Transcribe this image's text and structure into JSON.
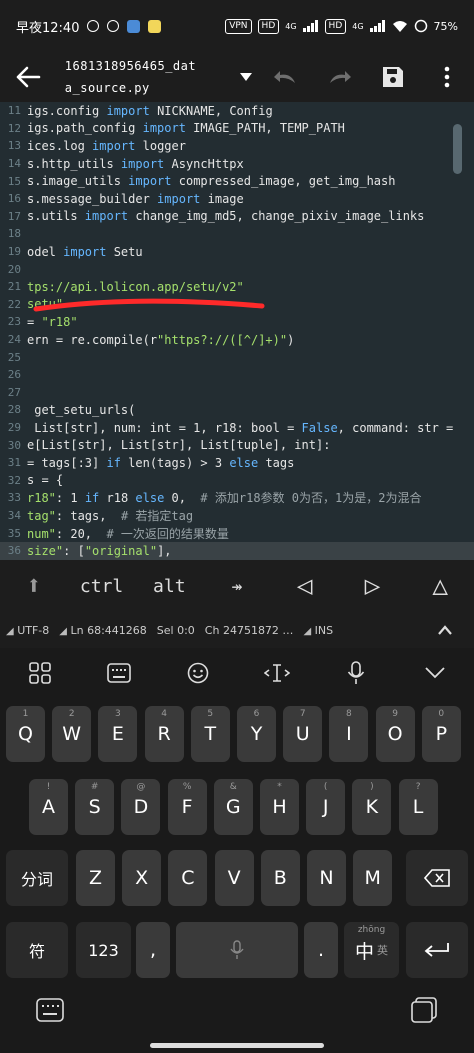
{
  "status_bar": {
    "time": "早夜12:40",
    "vpn": "VPN",
    "hd1": "HD",
    "net1": "4G",
    "hd2": "HD",
    "net2": "4G",
    "battery": "75%"
  },
  "toolbar": {
    "file_line1": "1681318956465_dat",
    "file_line2": "a_source.py"
  },
  "editor": {
    "lines": [
      {
        "n": "11",
        "segs": [
          [
            "def",
            "igs.config "
          ],
          [
            "kw",
            "import"
          ],
          [
            "def",
            " NICKNAME, Config"
          ]
        ]
      },
      {
        "n": "12",
        "segs": [
          [
            "def",
            "igs.path_config "
          ],
          [
            "kw",
            "import"
          ],
          [
            "def",
            " IMAGE_PATH, TEMP_PATH"
          ]
        ]
      },
      {
        "n": "13",
        "segs": [
          [
            "def",
            "ices.log "
          ],
          [
            "kw",
            "import"
          ],
          [
            "def",
            " logger"
          ]
        ]
      },
      {
        "n": "14",
        "segs": [
          [
            "def",
            "s.http_utils "
          ],
          [
            "kw",
            "import"
          ],
          [
            "def",
            " AsyncHttpx"
          ]
        ]
      },
      {
        "n": "15",
        "segs": [
          [
            "def",
            "s.image_utils "
          ],
          [
            "kw",
            "import"
          ],
          [
            "def",
            " compressed_image, get_img_hash"
          ]
        ]
      },
      {
        "n": "16",
        "segs": [
          [
            "def",
            "s.message_builder "
          ],
          [
            "kw",
            "import"
          ],
          [
            "def",
            " image"
          ]
        ]
      },
      {
        "n": "17",
        "segs": [
          [
            "def",
            "s.utils "
          ],
          [
            "kw",
            "import"
          ],
          [
            "def",
            " change_img_md5, change_pixiv_image_links"
          ]
        ]
      },
      {
        "n": "18",
        "segs": []
      },
      {
        "n": "19",
        "segs": [
          [
            "def",
            "odel "
          ],
          [
            "kw",
            "import"
          ],
          [
            "def",
            " Setu"
          ]
        ]
      },
      {
        "n": "20",
        "segs": []
      },
      {
        "n": "21",
        "segs": [
          [
            "str",
            "tps://api.lolicon.app/setu/v2\""
          ]
        ]
      },
      {
        "n": "22",
        "segs": [
          [
            "str",
            "setu\""
          ]
        ]
      },
      {
        "n": "23",
        "segs": [
          [
            "def",
            "= "
          ],
          [
            "str",
            "\"r18\""
          ]
        ]
      },
      {
        "n": "24",
        "segs": [
          [
            "def",
            "ern = re.compile(r"
          ],
          [
            "str",
            "\"https?://([^/]+)\""
          ],
          [
            "def",
            ")"
          ]
        ]
      },
      {
        "n": "25",
        "segs": []
      },
      {
        "n": "26",
        "segs": []
      },
      {
        "n": "27",
        "segs": []
      },
      {
        "n": "28",
        "segs": [
          [
            "def",
            " get_setu_urls("
          ]
        ]
      },
      {
        "n": "29",
        "segs": [
          [
            "def",
            " List[str], num: int = 1, r18: bool = "
          ],
          [
            "kw",
            "False"
          ],
          [
            "def",
            ", command: str ="
          ]
        ]
      },
      {
        "n": "30",
        "segs": [
          [
            "def",
            "e[List[str], List[str], List[tuple], int]:"
          ]
        ]
      },
      {
        "n": "31",
        "segs": [
          [
            "def",
            "= tags[:3] "
          ],
          [
            "kw",
            "if"
          ],
          [
            "def",
            " len(tags) > 3 "
          ],
          [
            "kw",
            "else"
          ],
          [
            "def",
            " tags"
          ]
        ]
      },
      {
        "n": "32",
        "segs": [
          [
            "def",
            "s = {"
          ]
        ]
      },
      {
        "n": "33",
        "segs": [
          [
            "str",
            "r18\""
          ],
          [
            "def",
            ": 1 "
          ],
          [
            "kw",
            "if"
          ],
          [
            "def",
            " r18 "
          ],
          [
            "kw",
            "else"
          ],
          [
            "def",
            " 0,  "
          ],
          [
            "cm",
            "# 添加r18参数 0为否，1为是，2为混合"
          ]
        ]
      },
      {
        "n": "34",
        "segs": [
          [
            "str",
            "tag\""
          ],
          [
            "def",
            ": tags,  "
          ],
          [
            "cm",
            "# 若指定tag"
          ]
        ]
      },
      {
        "n": "35",
        "segs": [
          [
            "str",
            "num\""
          ],
          [
            "def",
            ": 20,  "
          ],
          [
            "cm",
            "# 一次返回的结果数量"
          ]
        ]
      },
      {
        "n": "36",
        "segs": [
          [
            "str",
            "size\""
          ],
          [
            "def",
            ": ["
          ],
          [
            "str",
            "\"original\""
          ],
          [
            "def",
            "],"
          ]
        ]
      }
    ],
    "current_line": "36"
  },
  "symbol_bar": {
    "keys": [
      "⬆",
      "ctrl",
      "alt",
      "↠",
      "◁",
      "▷",
      "△"
    ]
  },
  "info_bar": {
    "encoding": "UTF-8",
    "position": "Ln 68:441268",
    "selection": "Sel 0:0",
    "chars": "Ch 24751872 …",
    "mode": "INS"
  },
  "keyboard": {
    "row1": [
      [
        "Q",
        "1"
      ],
      [
        "W",
        "2"
      ],
      [
        "E",
        "3"
      ],
      [
        "R",
        "4"
      ],
      [
        "T",
        "5"
      ],
      [
        "Y",
        "6"
      ],
      [
        "U",
        "7"
      ],
      [
        "I",
        "8"
      ],
      [
        "O",
        "9"
      ],
      [
        "P",
        "0"
      ]
    ],
    "row2": [
      [
        "A",
        "!"
      ],
      [
        "S",
        "#"
      ],
      [
        "D",
        "@"
      ],
      [
        "F",
        "%"
      ],
      [
        "G",
        "&"
      ],
      [
        "H",
        "*"
      ],
      [
        "J",
        "("
      ],
      [
        "K",
        ")"
      ],
      [
        "L",
        "?"
      ]
    ],
    "row3_left": "分词",
    "row3": [
      [
        "Z",
        ""
      ],
      [
        "X",
        ""
      ],
      [
        "C",
        ""
      ],
      [
        "V",
        ""
      ],
      [
        "B",
        ""
      ],
      [
        "N",
        ""
      ],
      [
        "M",
        ""
      ]
    ],
    "row4_symbols": "符",
    "row4_num": "123",
    "row4_comma": ",",
    "row4_period": ".",
    "row4_lang": "中",
    "row4_lang_hint": "zhōng",
    "row4_lang_sub": "英"
  },
  "colors": {
    "editor_bg": "#232d32",
    "keyword": "#66b7ff",
    "string": "#a5e06c",
    "scribble": "#ff2a2a"
  }
}
